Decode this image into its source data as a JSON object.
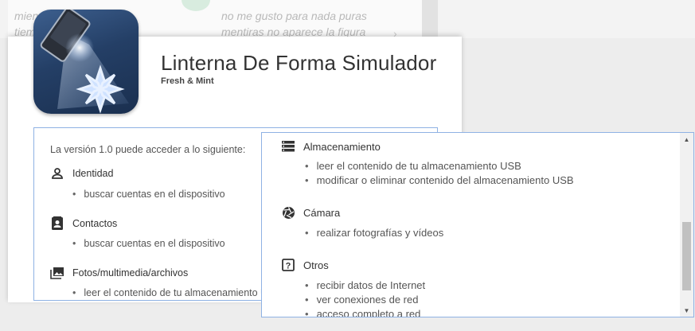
{
  "background": {
    "review1_line1": "mien",
    "review1_line2": "tiem",
    "review2_line1": "no me gusto para nada puras",
    "review2_line2": "mentiras no aparece la figura"
  },
  "app": {
    "title": "Linterna De Forma Simulador",
    "developer": "Fresh & Mint",
    "icon": "flashlight-snowflake-icon"
  },
  "permissions": {
    "intro": "La versión 1.0 puede acceder a lo siguiente:",
    "left": [
      {
        "label": "Identidad",
        "icon": "person-icon",
        "items": [
          "buscar cuentas en el dispositivo"
        ]
      },
      {
        "label": "Contactos",
        "icon": "contacts-icon",
        "items": [
          "buscar cuentas en el dispositivo"
        ]
      },
      {
        "label": "Fotos/multimedia/archivos",
        "icon": "photos-icon",
        "items": [
          "leer el contenido de tu almacenamiento U"
        ]
      }
    ],
    "right": [
      {
        "label": "Almacenamiento",
        "icon": "storage-icon",
        "items": [
          "leer el contenido de tu almacenamiento USB",
          "modificar o eliminar contenido del almacenamiento USB"
        ]
      },
      {
        "label": "Cámara",
        "icon": "camera-icon",
        "items": [
          "realizar fotografías y vídeos"
        ]
      },
      {
        "label": "Otros",
        "icon": "question-icon",
        "items": [
          "recibir datos de Internet",
          "ver conexiones de red",
          "acceso completo a red"
        ]
      }
    ]
  },
  "colors": {
    "panel_border": "#8fb2e4",
    "icon_bg": "#243f66"
  }
}
